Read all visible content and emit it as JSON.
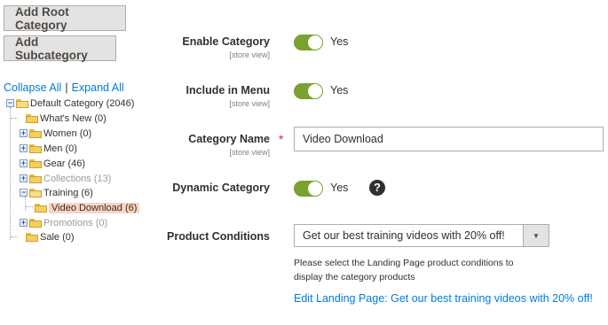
{
  "buttons": {
    "add_root": "Add Root Category",
    "add_sub": "Add Subcategory"
  },
  "tree_links": {
    "collapse": "Collapse All",
    "separator": "|",
    "expand": "Expand All"
  },
  "tree": {
    "root": "Default Category (2046)",
    "items": [
      {
        "label": "What's New (0)"
      },
      {
        "label": "Women (0)"
      },
      {
        "label": "Men (0)"
      },
      {
        "label": "Gear (46)"
      },
      {
        "label": "Collections (13)"
      },
      {
        "label": "Training (6)"
      },
      {
        "label": "Video Download (6)"
      },
      {
        "label": "Promotions (0)"
      },
      {
        "label": "Sale (0)"
      }
    ]
  },
  "form": {
    "enable": {
      "label": "Enable Category",
      "scope": "[store view]",
      "value": "Yes"
    },
    "include_menu": {
      "label": "Include in Menu",
      "scope": "[store view]",
      "value": "Yes"
    },
    "name": {
      "label": "Category Name",
      "scope": "[store view]",
      "required_mark": "*",
      "value": "Video Download"
    },
    "dynamic": {
      "label": "Dynamic Category",
      "value": "Yes",
      "help": "?"
    },
    "conditions": {
      "label": "Product Conditions",
      "selected": "Get our best training videos with 20% off!",
      "note": "Please select the Landing Page product conditions to display the category products",
      "edit_link": "Edit Landing Page: Get our best training videos with 20% off!"
    }
  },
  "colors": {
    "toggle_on": "#79a22e",
    "link": "#007bdb",
    "required": "#e22626",
    "selected_node": "#fbd4c1"
  }
}
